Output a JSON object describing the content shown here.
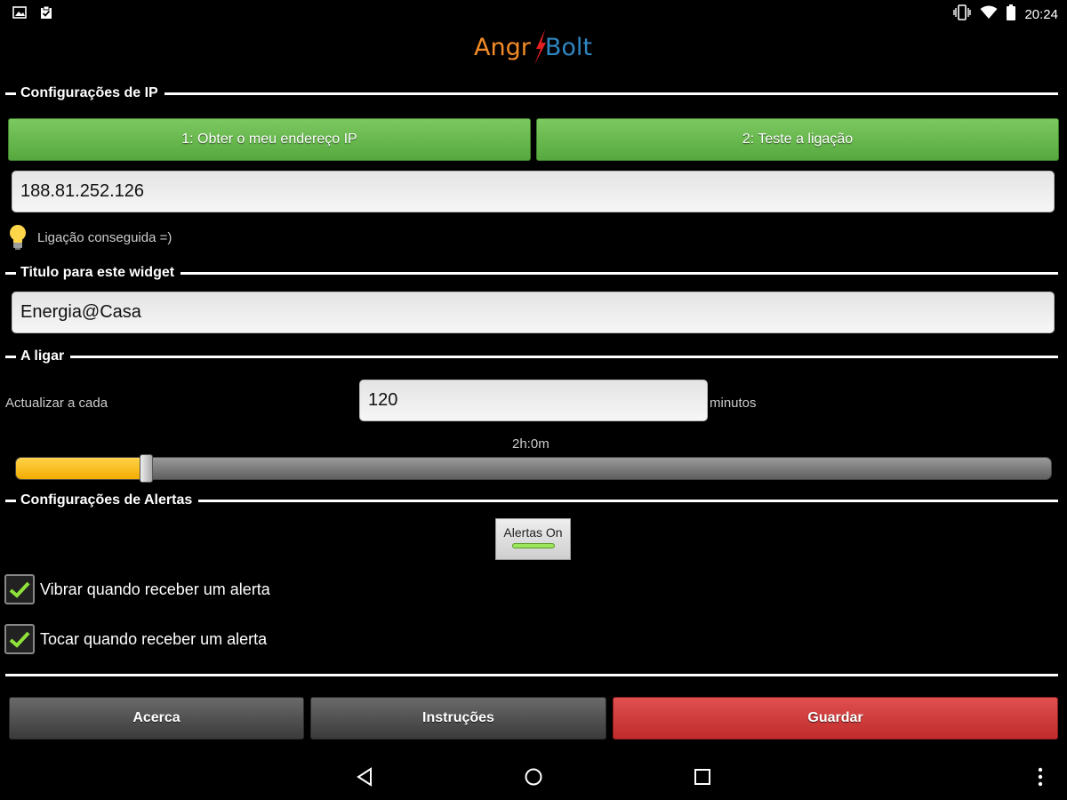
{
  "status_bar": {
    "time": "20:24",
    "left_icons": [
      "image-icon",
      "clipboard-check-icon"
    ],
    "right_icons": [
      "vibrate-icon",
      "wifi-icon",
      "battery-icon"
    ]
  },
  "logo": {
    "part1": "Angr",
    "part2": "Bolt",
    "color1": "#f28c28",
    "color2": "#2e86c1",
    "bolt_color": "#e02020"
  },
  "ip_section": {
    "title": "Configurações de IP",
    "get_ip_button": "1: Obter o meu endereço IP",
    "test_button": "2: Teste a ligação",
    "ip_value": "188.81.252.126",
    "status_icon": "lightbulb-icon",
    "status_text": "Ligação conseguida =)"
  },
  "title_section": {
    "title": "Titulo para este widget",
    "widget_title_value": "Energia@Casa"
  },
  "connect_section": {
    "title": "A ligar",
    "update_label": "Actualizar a cada",
    "update_value": "120",
    "unit": "minutos",
    "slider_value_label": "2h:0m",
    "slider_fraction": 0.126
  },
  "alerts_section": {
    "title": "Configurações de Alertas",
    "toggle_label": "Alertas On",
    "vibrate_label": "Vibrar quando receber um alerta",
    "vibrate_checked": true,
    "sound_label": "Tocar quando receber um alerta",
    "sound_checked": true
  },
  "footer": {
    "about": "Acerca",
    "instructions": "Instruções",
    "save": "Guardar"
  },
  "navbar": {
    "icons": [
      "back-icon",
      "home-icon",
      "recents-icon",
      "overflow-menu-icon"
    ]
  },
  "colors": {
    "accent_green": "#6bbd50",
    "slider_fill": "#f2ad00",
    "save_red": "#d13b3b"
  }
}
